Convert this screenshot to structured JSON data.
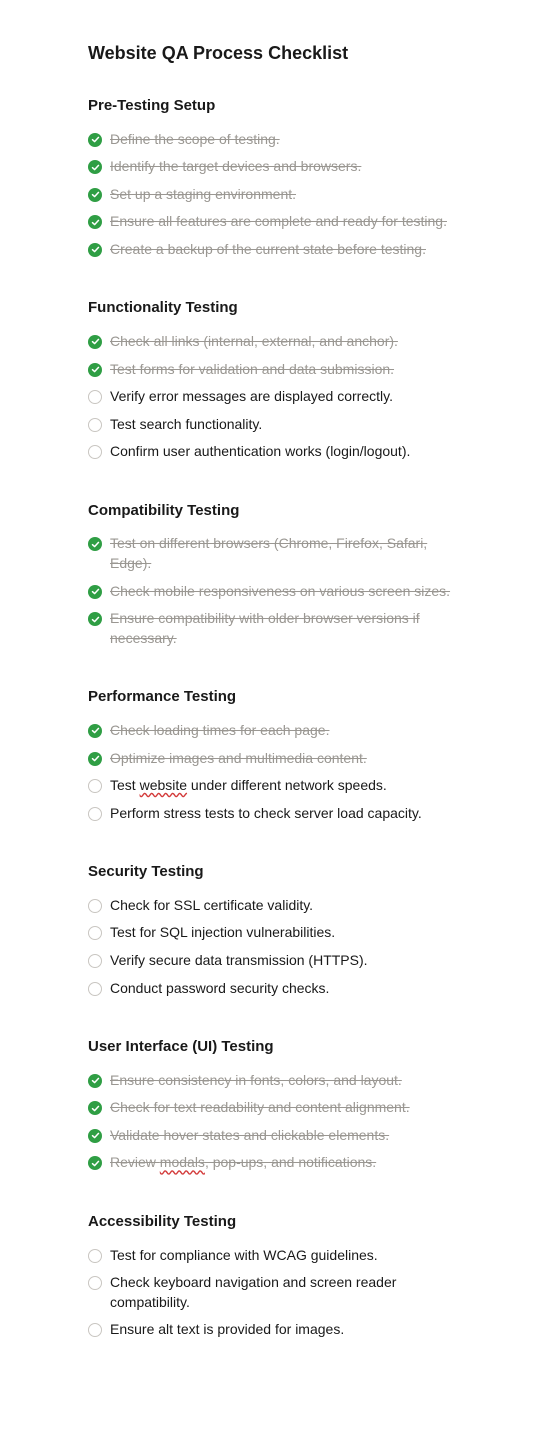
{
  "title": "Website QA Process Checklist",
  "sections": [
    {
      "heading": "Pre-Testing Setup",
      "items": [
        {
          "checked": true,
          "text": "Define the scope of testing."
        },
        {
          "checked": true,
          "text": "Identify the target devices and browsers."
        },
        {
          "checked": true,
          "text": "Set up a staging environment."
        },
        {
          "checked": true,
          "text": "Ensure all features are complete and ready for testing."
        },
        {
          "checked": true,
          "text": "Create a backup of the current state before testing."
        }
      ]
    },
    {
      "heading": "Functionality Testing",
      "items": [
        {
          "checked": true,
          "text": "Check all links (internal, external, and anchor)."
        },
        {
          "checked": true,
          "text": "Test forms for validation and data submission."
        },
        {
          "checked": false,
          "text": "Verify error messages are displayed correctly."
        },
        {
          "checked": false,
          "text": "Test search functionality."
        },
        {
          "checked": false,
          "text": "Confirm user authentication works (login/logout)."
        }
      ]
    },
    {
      "heading": "Compatibility Testing",
      "items": [
        {
          "checked": true,
          "text": "Test on different browsers (Chrome, Firefox, Safari, Edge)."
        },
        {
          "checked": true,
          "text": "Check mobile responsiveness on various screen sizes."
        },
        {
          "checked": true,
          "text": "Ensure compatibility with older browser versions if necessary."
        }
      ]
    },
    {
      "heading": "Performance Testing",
      "items": [
        {
          "checked": true,
          "text": "Check loading times for each page."
        },
        {
          "checked": true,
          "text": "Optimize images and multimedia content."
        },
        {
          "checked": false,
          "parts": [
            {
              "text": "Test "
            },
            {
              "text": "website",
              "spell": true
            },
            {
              "text": " under different network speeds."
            }
          ]
        },
        {
          "checked": false,
          "text": "Perform stress tests to check server load capacity."
        }
      ]
    },
    {
      "heading": "Security Testing",
      "items": [
        {
          "checked": false,
          "text": "Check for SSL certificate validity."
        },
        {
          "checked": false,
          "text": "Test for SQL injection vulnerabilities."
        },
        {
          "checked": false,
          "text": "Verify secure data transmission (HTTPS)."
        },
        {
          "checked": false,
          "text": "Conduct password security checks."
        }
      ]
    },
    {
      "heading": "User Interface (UI) Testing",
      "items": [
        {
          "checked": true,
          "text": "Ensure consistency in fonts, colors, and layout."
        },
        {
          "checked": true,
          "text": "Check for text readability and content alignment."
        },
        {
          "checked": true,
          "text": "Validate hover states and clickable elements."
        },
        {
          "checked": true,
          "parts": [
            {
              "text": "Review "
            },
            {
              "text": "modals",
              "spell": true
            },
            {
              "text": ", pop-ups, and notifications."
            }
          ]
        }
      ]
    },
    {
      "heading": "Accessibility Testing",
      "items": [
        {
          "checked": false,
          "text": "Test for compliance with WCAG guidelines."
        },
        {
          "checked": false,
          "text": "Check keyboard navigation and screen reader compatibility."
        },
        {
          "checked": false,
          "text": "Ensure alt text is provided for images."
        }
      ]
    }
  ]
}
